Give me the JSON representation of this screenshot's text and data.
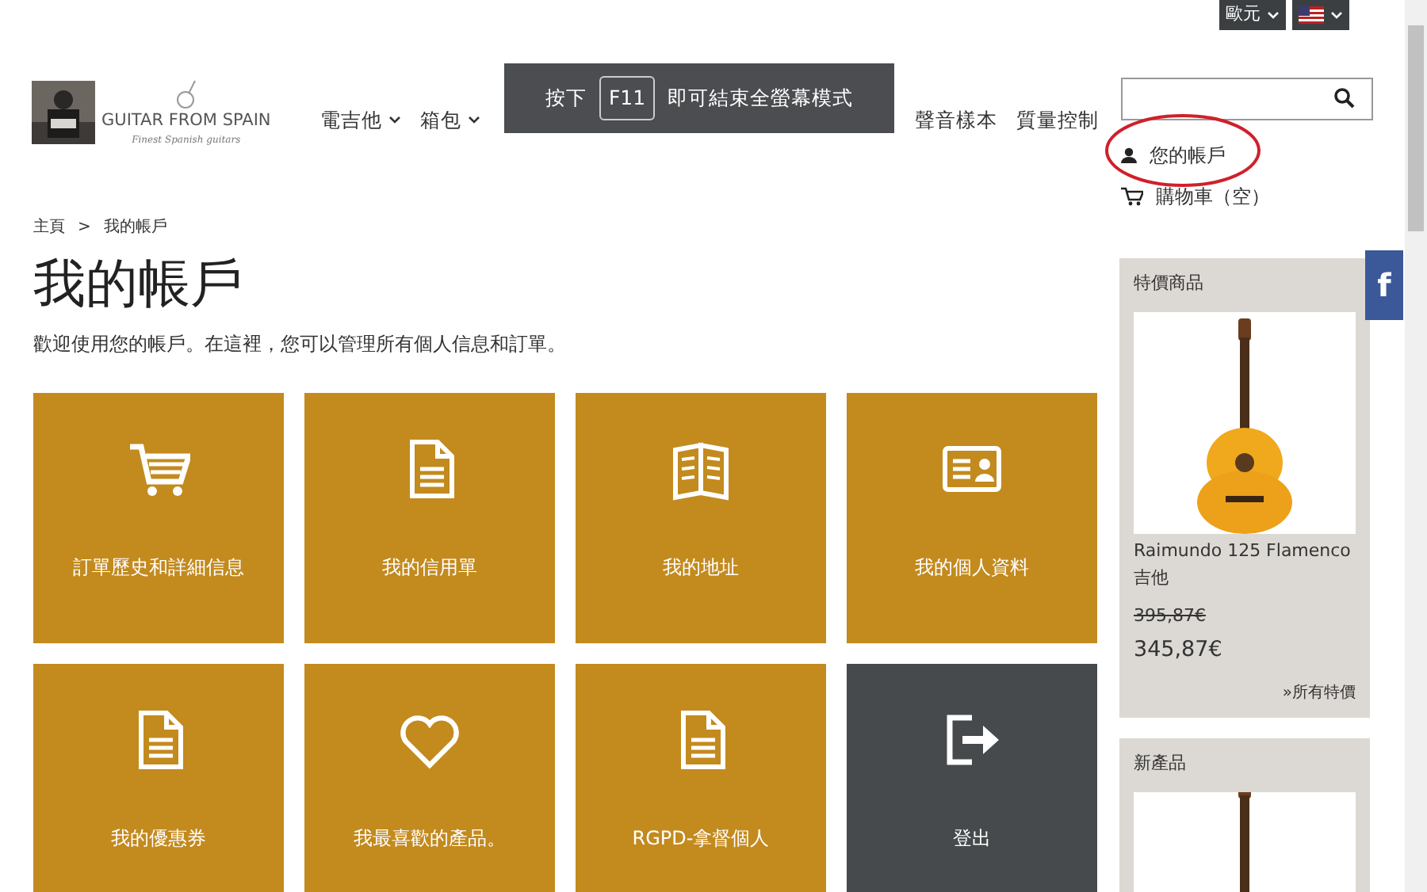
{
  "top_bar": {
    "currency": "歐元"
  },
  "logo": {
    "name": "GUITAR FROM SPAIN",
    "tagline": "Finest Spanish guitars"
  },
  "nav": [
    {
      "label": "電吉他",
      "dropdown": true
    },
    {
      "label": "箱包",
      "dropdown": true
    },
    {
      "label": "聲音樣本",
      "dropdown": false
    },
    {
      "label": "質量控制",
      "dropdown": false
    }
  ],
  "fullscreen_notice": {
    "before": "按下",
    "key": "F11",
    "after": "即可結束全螢幕模式"
  },
  "account_link": {
    "label": "您的帳戶",
    "circled": true
  },
  "cart_link": {
    "label": "購物車（空）"
  },
  "breadcrumb": [
    "主頁",
    "我的帳戶"
  ],
  "breadcrumb_separator": ">",
  "page_title": "我的帳戶",
  "intro": "歡迎使用您的帳戶。在這裡，您可以管理所有個人信息和訂單。",
  "tiles": [
    {
      "kind": "cart",
      "label": "訂單歷史和詳細信息",
      "color": "#c38a1e"
    },
    {
      "kind": "document",
      "label": "我的信用單",
      "color": "#c38a1e"
    },
    {
      "kind": "book",
      "label": "我的地址",
      "color": "#c38a1e"
    },
    {
      "kind": "idcard",
      "label": "我的個人資料",
      "color": "#c38a1e"
    },
    {
      "kind": "document",
      "label": "我的優惠券",
      "color": "#c38a1e"
    },
    {
      "kind": "heart",
      "label": "我最喜歡的產品。",
      "color": "#c38a1e"
    },
    {
      "kind": "document",
      "label": "RGPD-拿督個人",
      "color": "#c38a1e"
    },
    {
      "kind": "logout",
      "label": "登出",
      "color": "#464a4d"
    }
  ],
  "sidebar": [
    {
      "title": "特價商品",
      "product": {
        "kind": "picture",
        "name": "Raimundo 125 Flamenco吉他",
        "old_price": "395,87€",
        "price": "345,87€"
      },
      "more_link": "»所有特價"
    },
    {
      "title": "新產品"
    }
  ],
  "social": {
    "letter": "f"
  }
}
